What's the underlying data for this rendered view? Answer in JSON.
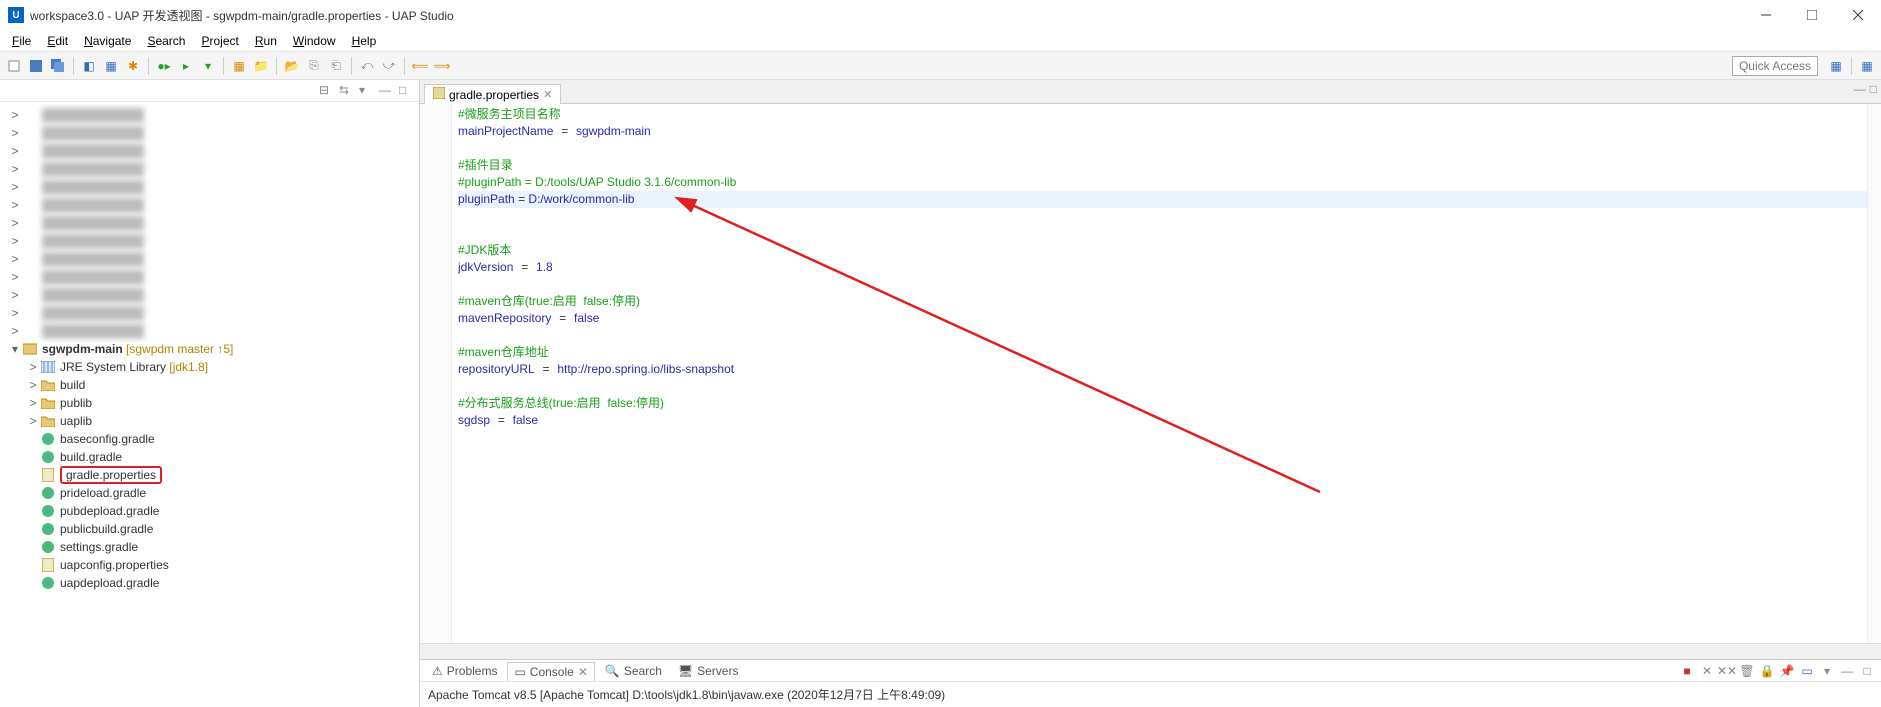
{
  "window": {
    "title": "workspace3.0 - UAP 开发透视图 - sgwpdm-main/gradle.properties - UAP Studio",
    "app_icon_letter": "U"
  },
  "menu": {
    "items": [
      "File",
      "Edit",
      "Navigate",
      "Search",
      "Project",
      "Run",
      "Window",
      "Help"
    ]
  },
  "toolbar": {
    "quick_access": "Quick Access"
  },
  "tree": {
    "project": {
      "name": "sgwpdm-main",
      "decor": "[sgwpdm master ↑5]"
    },
    "items": [
      {
        "label": "JRE System Library",
        "decor": "[jdk1.8]",
        "icon": "lib",
        "indent": 1,
        "toggle": ">"
      },
      {
        "label": "build",
        "icon": "folder",
        "indent": 1,
        "toggle": ">"
      },
      {
        "label": "publib",
        "icon": "folder",
        "indent": 1,
        "toggle": ">"
      },
      {
        "label": "uaplib",
        "icon": "folder",
        "indent": 1,
        "toggle": ">"
      },
      {
        "label": "baseconfig.gradle",
        "icon": "gradle",
        "indent": 1
      },
      {
        "label": "build.gradle",
        "icon": "gradle",
        "indent": 1
      },
      {
        "label": "gradle.properties",
        "icon": "props",
        "indent": 1,
        "highlighted": true
      },
      {
        "label": "prideload.gradle",
        "icon": "gradle",
        "indent": 1
      },
      {
        "label": "pubdepload.gradle",
        "icon": "gradle",
        "indent": 1
      },
      {
        "label": "publicbuild.gradle",
        "icon": "gradle",
        "indent": 1
      },
      {
        "label": "settings.gradle",
        "icon": "gradle",
        "indent": 1
      },
      {
        "label": "uapconfig.properties",
        "icon": "props",
        "indent": 1
      },
      {
        "label": "uapdepload.gradle",
        "icon": "gradle",
        "indent": 1
      }
    ]
  },
  "editor": {
    "tab_label": "gradle.properties",
    "lines": [
      {
        "t": "comment",
        "text": "#微服务主项目名称"
      },
      {
        "t": "kv",
        "key": "mainProjectName",
        "val": "sgwpdm-main"
      },
      {
        "t": "blank"
      },
      {
        "t": "comment",
        "text": "#插件目录"
      },
      {
        "t": "comment",
        "text": "#pluginPath = D:/tools/UAP Studio 3.1.6/common-lib"
      },
      {
        "t": "kv",
        "key": "pluginPath",
        "val": "D:/work/common-lib",
        "hl": true
      },
      {
        "t": "blank"
      },
      {
        "t": "comment",
        "text": "#JDK版本"
      },
      {
        "t": "kv",
        "key": "jdkVersion",
        "val": "1.8"
      },
      {
        "t": "blank"
      },
      {
        "t": "comment",
        "text": "#maven仓库(true:启用  false:停用)"
      },
      {
        "t": "kv",
        "key": "mavenRepository",
        "val": "false"
      },
      {
        "t": "blank"
      },
      {
        "t": "comment",
        "text": "#maven仓库地址"
      },
      {
        "t": "kv",
        "key": "repositoryURL",
        "val": "http://repo.spring.io/libs-snapshot"
      },
      {
        "t": "blank"
      },
      {
        "t": "comment",
        "text": "#分布式服务总线(true:启用  false:停用)"
      },
      {
        "t": "kv",
        "key": "sgdsp",
        "val": "false"
      }
    ]
  },
  "bottom": {
    "tabs": [
      "Problems",
      "Console",
      "Search",
      "Servers"
    ],
    "active_tab": 1,
    "console_line": "Apache Tomcat v8.5 [Apache Tomcat] D:\\tools\\jdk1.8\\bin\\javaw.exe (2020年12月7日 上午8:49:09)"
  }
}
